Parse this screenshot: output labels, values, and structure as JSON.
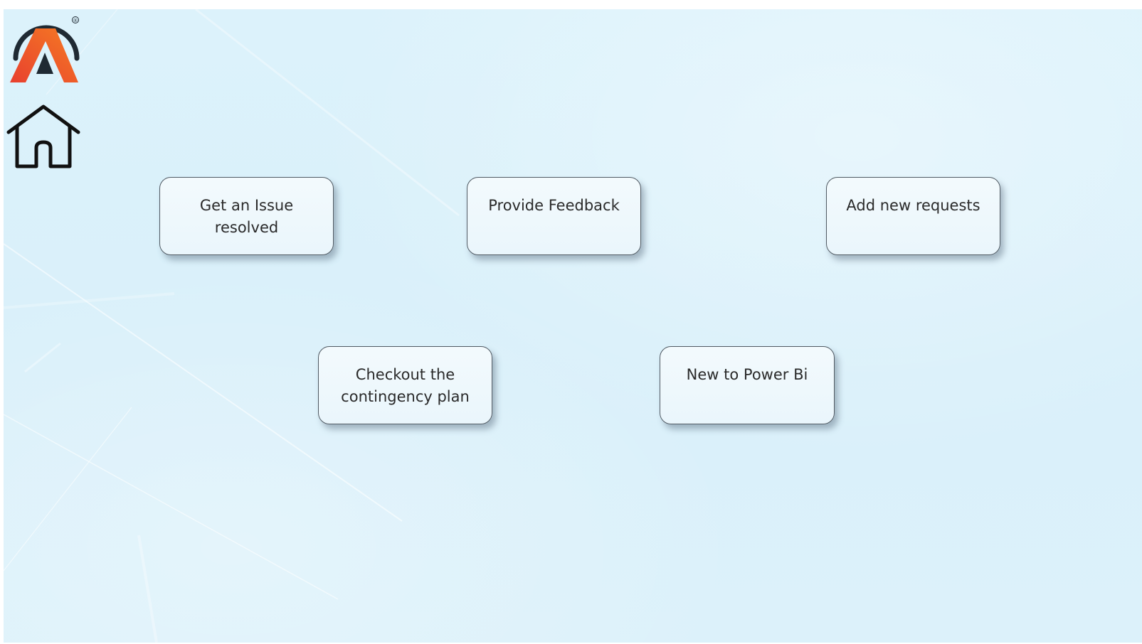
{
  "brand": {
    "logo_icon": "brand-a-logo-icon",
    "registered_mark": "®",
    "accent_colors": [
      "#e84b36",
      "#f26b21",
      "#1f2a33"
    ]
  },
  "nav": {
    "home_icon": "home-icon"
  },
  "buttons": {
    "issue": "Get an Issue resolved",
    "feedback": "Provide Feedback",
    "requests": "Add new requests",
    "contingency": "Checkout the contingency plan",
    "powerbi": "New to Power Bi"
  },
  "colors": {
    "background": "#dcf2fb",
    "card_fill": "#eef8fc",
    "card_border": "#505a63"
  }
}
